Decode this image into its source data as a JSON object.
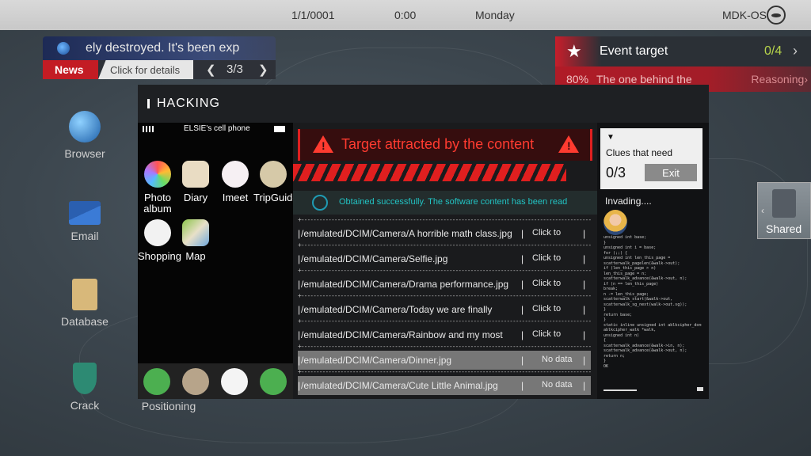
{
  "status_bar": {
    "date": "1/1/0001",
    "time": "0:00",
    "weekday": "Monday",
    "os": "MDK-OS"
  },
  "news": {
    "ticker": "ely destroyed.  It's been exp",
    "label": "News",
    "details": "Click for details",
    "page": "3/3",
    "prev": "❮",
    "next": "❯"
  },
  "event": {
    "title": "Event target",
    "count": "0/4",
    "percent": "80%",
    "description": "The one behind the",
    "reasoning": "Reasoning›"
  },
  "desktop": [
    {
      "label": "Browser",
      "icon": "globe-icon"
    },
    {
      "label": "Email",
      "icon": "envelope-icon"
    },
    {
      "label": "Database",
      "icon": "database-icon"
    },
    {
      "label": "Crack",
      "icon": "shield-icon"
    },
    {
      "label": "Positioning",
      "icon": "location-icon"
    }
  ],
  "shared_label": "Shared",
  "hacking": {
    "title": "HACKING",
    "phone_name": "ELSIE's cell phone",
    "apps": [
      {
        "label": "Photo album",
        "icon": "photos-icon"
      },
      {
        "label": "Diary",
        "icon": "book-icon"
      },
      {
        "label": "Imeet",
        "icon": "chat-icon"
      },
      {
        "label": "TripGuide",
        "icon": "plane-icon"
      },
      {
        "label": "Shopping",
        "icon": "shopping-icon"
      },
      {
        "label": "Map",
        "icon": "map-icon"
      }
    ],
    "dock": [
      "phone-icon",
      "contacts-icon",
      "google-icon",
      "messages-icon"
    ],
    "warning": "Target attracted by the content",
    "success": "Obtained successfully. The software content has been read",
    "files": [
      {
        "path": "/emulated/DCIM/Camera/A horrible math class.jpg",
        "action": "Click to",
        "state": "normal"
      },
      {
        "path": "/emulated/DCIM/Camera/Selfie.jpg",
        "action": "Click to",
        "state": "normal"
      },
      {
        "path": "/emulated/DCIM/Camera/Drama performance.jpg",
        "action": "Click to",
        "state": "normal"
      },
      {
        "path": "/emulated/DCIM/Camera/Today we are finally",
        "action": "Click to",
        "state": "normal"
      },
      {
        "path": "/emulated/DCIM/Camera/Rainbow and my most",
        "action": "Click to",
        "state": "normal"
      },
      {
        "path": "/emulated/DCIM/Camera/Dinner.jpg",
        "action": "No data",
        "state": "nodata"
      },
      {
        "path": "/emulated/DCIM/Camera/Cute Little Animal.jpg",
        "action": "No data",
        "state": "nodata"
      }
    ],
    "clues_label": "Clues that need",
    "clues_count": "0/3",
    "exit": "Exit",
    "invading": "Invading....",
    "code": "unsigned int base;\n}\nunsigned int i = base;\nfor (;;) {\nunsigned int len_this_page =\nscatterwalk_pagelen(&walk->out);\nif (len_this_page > n)\nlen_this_page = n;\nscatterwalk_advance(&walk->out, n);\nif (n == len_this_page)\nbreak;\nn -= len_this_page;\nscatterwalk_start(&walk->out,\nscatterwalk_sg_next(walk->out.sg));\n}\nreturn base;\n}\nstatic inline unsigned int ablkcipher_done_fast(struct\nablkcipher_walk *walk,\nunsigned int n)\n{\nscatterwalk_advance(&walk->in, n);\nscatterwalk_advance(&walk->out, n);\nreturn n;\n}\nOK"
  }
}
